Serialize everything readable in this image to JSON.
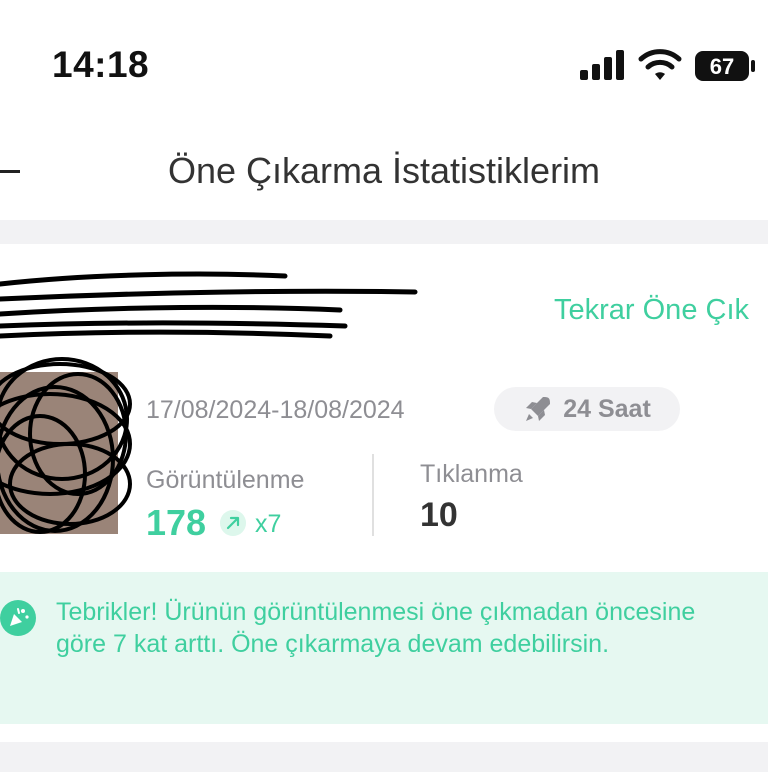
{
  "status_bar": {
    "time": "14:18",
    "battery": "67"
  },
  "header": {
    "title": "Öne Çıkarma İstatistiklerim"
  },
  "card": {
    "repromote_label": "Tekrar Öne Çık",
    "date_range": "17/08/2024-18/08/2024",
    "duration": "24 Saat",
    "views_label": "Görüntülenme",
    "views_value": "178",
    "views_multiplier": "x7",
    "clicks_label": "Tıklanma",
    "clicks_value": "10"
  },
  "banner": {
    "message": "Tebrikler! Ürünün görüntülenmesi öne çıkmadan öncesine göre 7 kat arttı. Öne çıkarmaya devam edebilirsin."
  },
  "colors": {
    "accent": "#3fcf9f",
    "muted": "#8e8e93",
    "banner_bg": "#e6f8f1"
  },
  "icons": [
    "signal-icon",
    "wifi-icon",
    "battery-icon",
    "back-icon",
    "rocket-icon",
    "trend-up-icon",
    "party-icon"
  ]
}
